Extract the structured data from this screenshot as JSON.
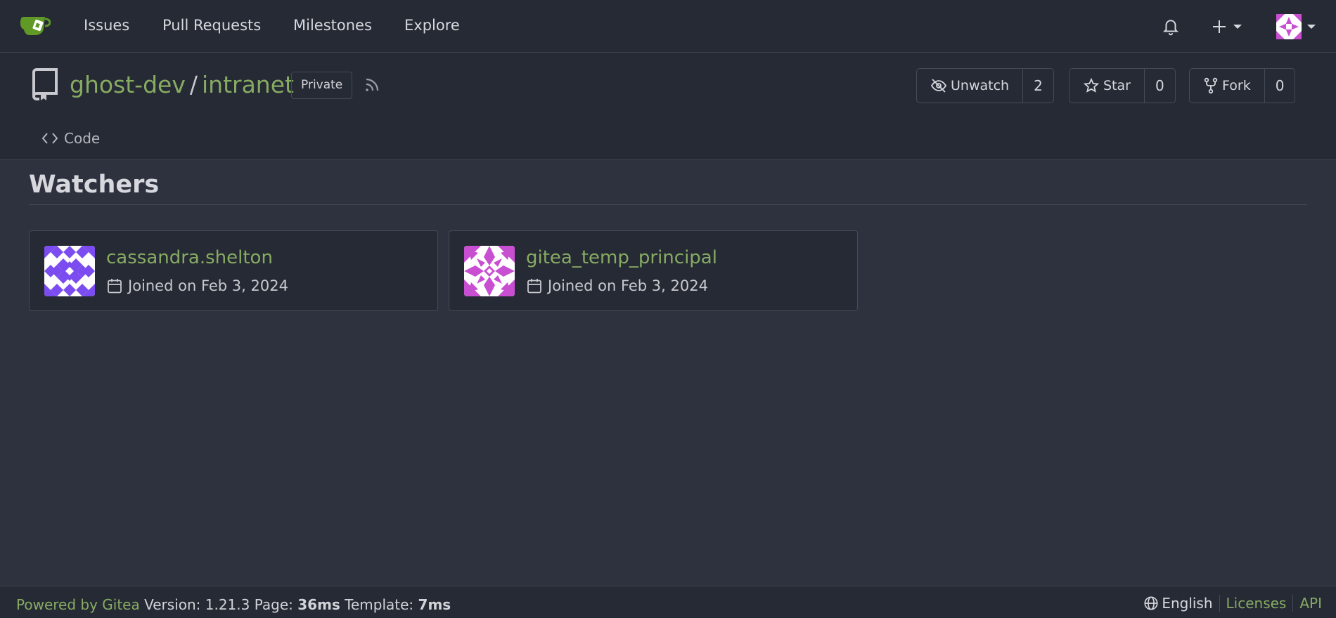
{
  "nav": {
    "items": [
      "Issues",
      "Pull Requests",
      "Milestones",
      "Explore"
    ]
  },
  "repo": {
    "owner": "ghost-dev",
    "separator": "/",
    "name": "intranet",
    "visibility": "Private",
    "watch_label": "Unwatch",
    "watch_count": "2",
    "star_label": "Star",
    "star_count": "0",
    "fork_label": "Fork",
    "fork_count": "0",
    "code_tab": "Code"
  },
  "page": {
    "heading": "Watchers"
  },
  "watchers": [
    {
      "name": "cassandra.shelton",
      "joined": "Joined on Feb 3, 2024",
      "avatar_color": "#7b4df0"
    },
    {
      "name": "gitea_temp_principal",
      "joined": "Joined on Feb 3, 2024",
      "avatar_color": "#c84fd2"
    }
  ],
  "footer": {
    "powered_by": "Powered by Gitea",
    "version_text": "Version: 1.21.3 Page:",
    "page_time": "36ms",
    "template_label": "Template:",
    "template_time": "7ms",
    "language": "English",
    "licenses": "Licenses",
    "api": "API"
  },
  "colors": {
    "accent_green": "#87ab63",
    "navbar_bg": "#262a34",
    "page_bg": "#2e323e"
  },
  "icons": [
    "gitea-logo-icon",
    "bell-icon",
    "plus-icon",
    "avatar-icon",
    "repo-icon",
    "rss-icon",
    "eye-slash-icon",
    "star-icon",
    "fork-icon",
    "code-icon",
    "calendar-icon",
    "globe-icon"
  ]
}
